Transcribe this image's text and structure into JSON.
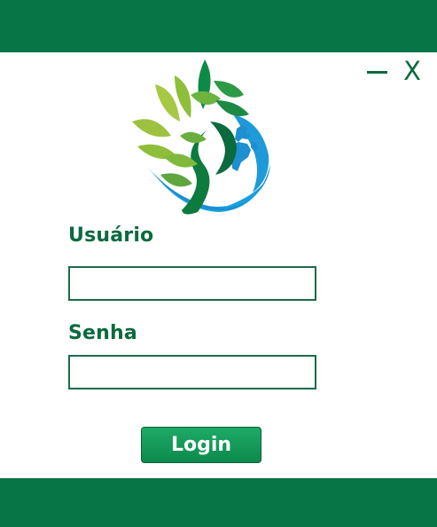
{
  "window": {
    "minimize_icon": "minimize-icon",
    "close_symbol": "X",
    "bar_color": "#077545"
  },
  "logo": {
    "icon": "tree-globe-logo"
  },
  "form": {
    "username_label": "Usuário",
    "username_value": "",
    "password_label": "Senha",
    "password_value": "",
    "login_label": "Login"
  },
  "colors": {
    "accent": "#0b6a3e",
    "button": "#149b58"
  }
}
